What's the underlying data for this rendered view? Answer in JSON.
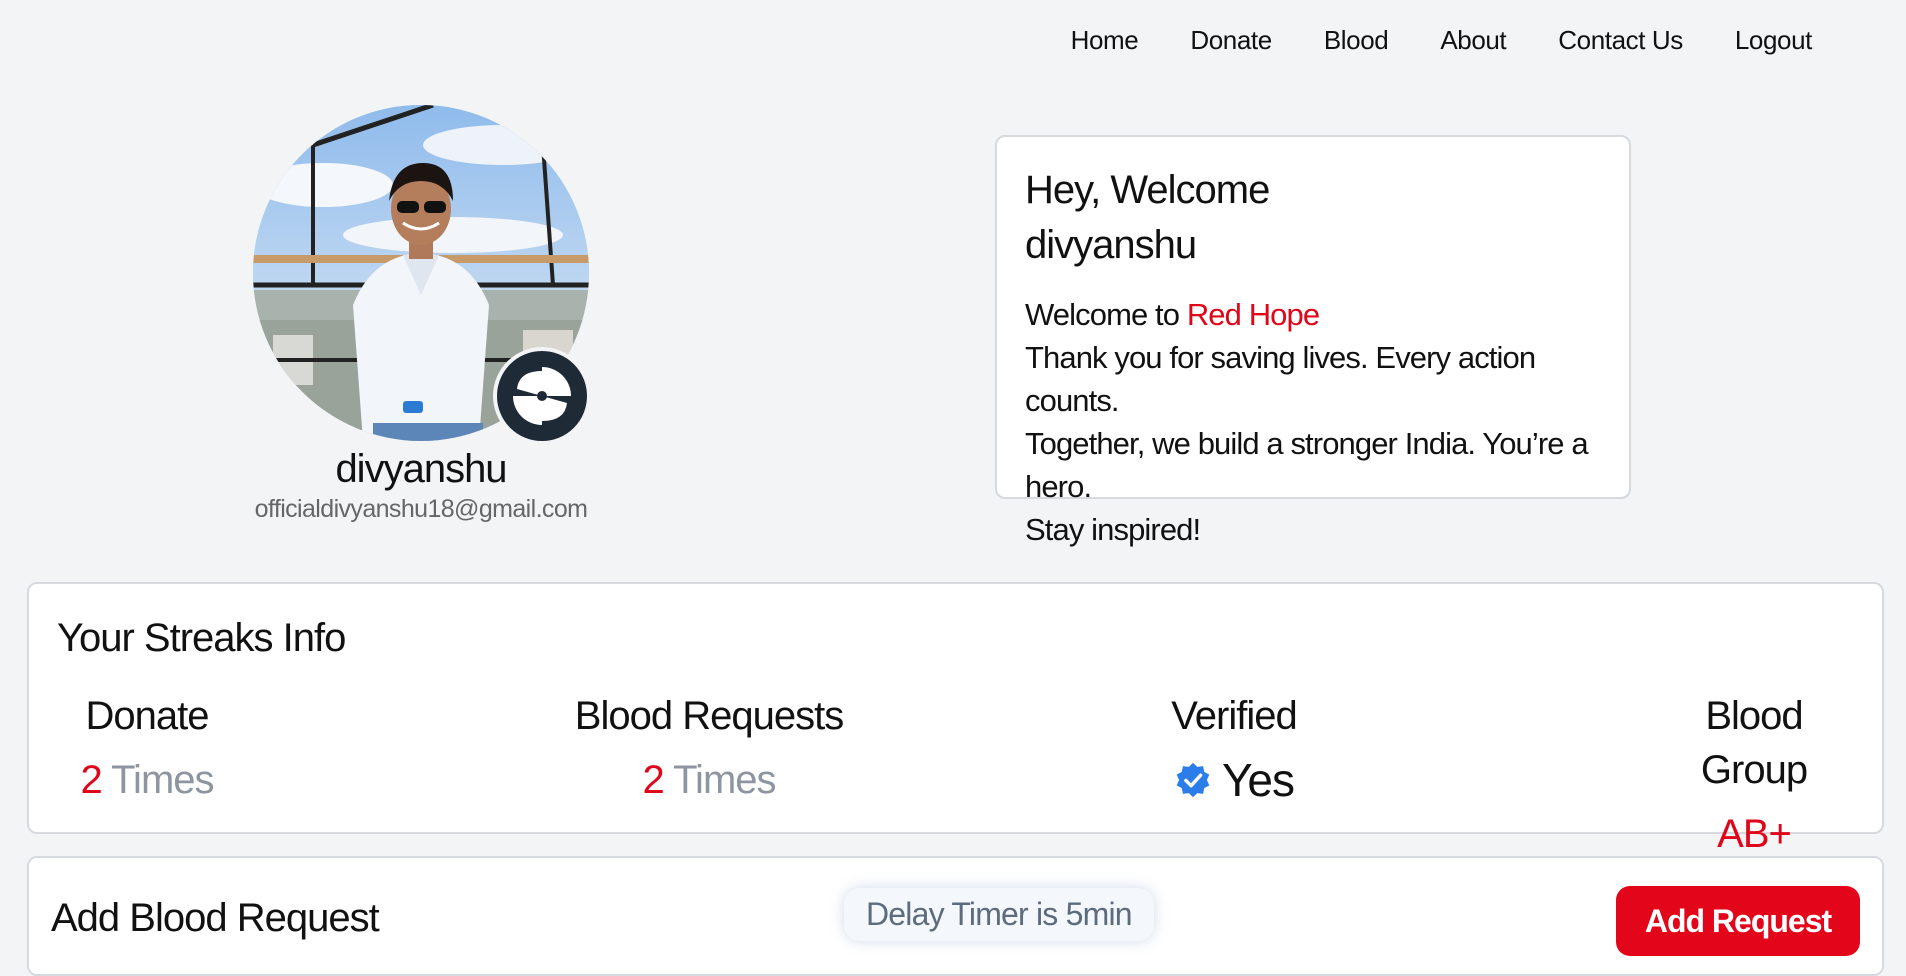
{
  "nav": {
    "items": [
      {
        "label": "Home"
      },
      {
        "label": "Donate"
      },
      {
        "label": "Blood"
      },
      {
        "label": "About"
      },
      {
        "label": "Contact Us"
      },
      {
        "label": "Logout"
      }
    ]
  },
  "profile": {
    "name": "divyanshu",
    "email": "officialdivyanshu18@gmail.com"
  },
  "welcome": {
    "greeting": "Hey, Welcome",
    "username": "divyanshu",
    "intro_prefix": "Welcome to ",
    "brand": "Red Hope",
    "line1": "Thank you for saving lives. Every action counts.",
    "line2": "Together, we build a stronger India. You’re a hero.",
    "line3": "Stay inspired!"
  },
  "streaks": {
    "title": "Your Streaks Info",
    "donate": {
      "label": "Donate",
      "count": "2",
      "unit": "Times"
    },
    "blood_requests": {
      "label": "Blood Requests",
      "count": "2",
      "unit": "Times"
    },
    "verified": {
      "label": "Verified",
      "value": "Yes"
    },
    "blood_group": {
      "label": "Blood Group",
      "value": "AB+"
    }
  },
  "request": {
    "title": "Add Blood Request",
    "delay_timer": "Delay Timer is 5min",
    "button_label": "Add Request"
  },
  "colors": {
    "accent_red": "#e0061a",
    "verified_blue": "#2b7de9",
    "background": "#f3f4f6"
  }
}
